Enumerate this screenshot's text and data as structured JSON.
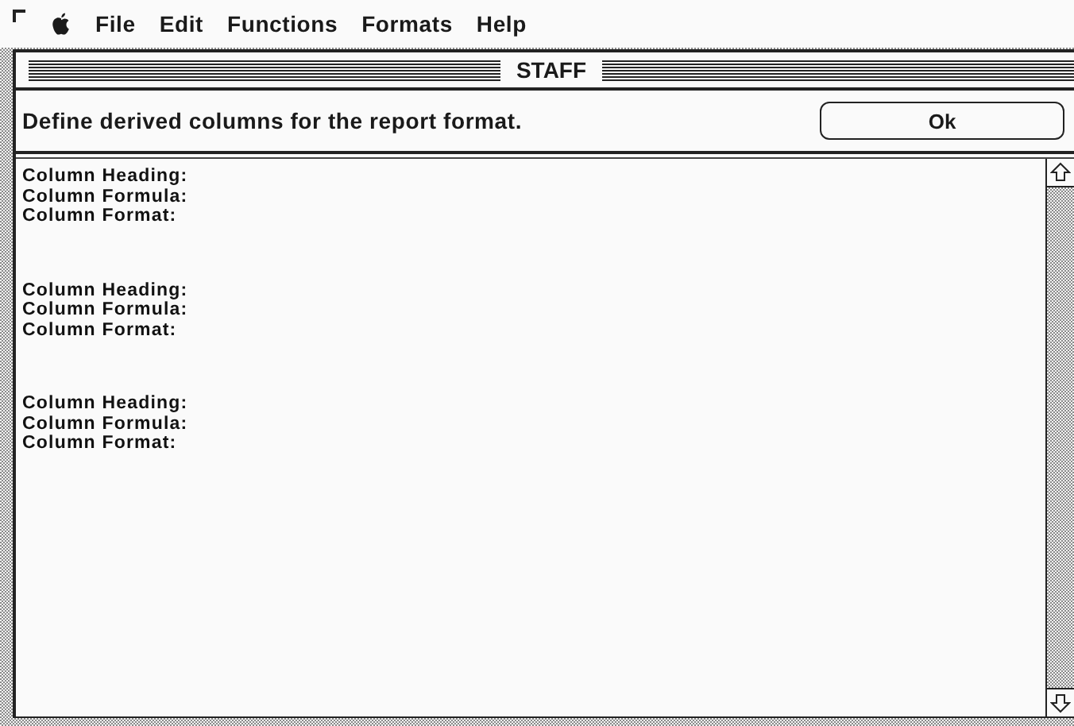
{
  "menu_bar": {
    "items": [
      "File",
      "Edit",
      "Functions",
      "Formats",
      "Help"
    ]
  },
  "window": {
    "title": "STAFF"
  },
  "prompt": {
    "text": "Define derived columns for the report format.",
    "button": "Ok"
  },
  "column_definitions": [
    {
      "lines": [
        "Column Heading:",
        "Column Formula:",
        "Column Format:"
      ]
    },
    {
      "lines": [
        "Column Heading:",
        "Column Formula:",
        "Column Format:"
      ]
    },
    {
      "lines": [
        "Column Heading:",
        "Column Formula:",
        "Column Format:"
      ]
    }
  ]
}
